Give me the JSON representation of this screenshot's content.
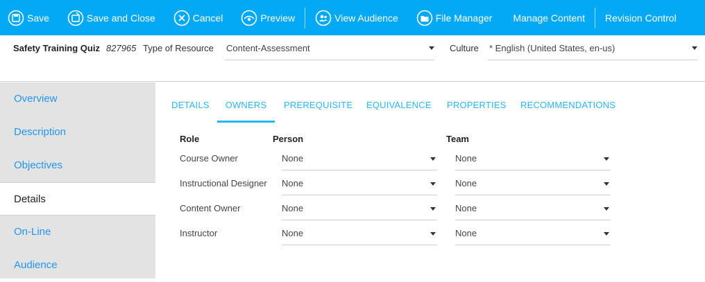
{
  "toolbar": {
    "save": "Save",
    "save_and_close": "Save and Close",
    "cancel": "Cancel",
    "preview": "Preview",
    "view_audience": "View Audience",
    "file_manager": "File Manager",
    "manage_content": "Manage Content",
    "revision_control": "Revision Control"
  },
  "header": {
    "title": "Safety Training Quiz",
    "id": "827965",
    "type_label": "Type of Resource",
    "type_value": "Content-Assessment",
    "culture_label": "Culture",
    "culture_value": "* English (United States, en-us)"
  },
  "sidebar": {
    "items": [
      {
        "label": "Overview"
      },
      {
        "label": "Description"
      },
      {
        "label": "Objectives"
      },
      {
        "label": "Details"
      },
      {
        "label": "On-Line"
      },
      {
        "label": "Audience"
      }
    ],
    "active": "Details"
  },
  "tabs": [
    {
      "label": "DETAILS"
    },
    {
      "label": "OWNERS"
    },
    {
      "label": "PREREQUISITE"
    },
    {
      "label": "EQUIVALENCE"
    },
    {
      "label": "PROPERTIES"
    },
    {
      "label": "RECOMMENDATIONS"
    }
  ],
  "owners": {
    "columns": {
      "role": "Role",
      "person": "Person",
      "team": "Team"
    },
    "rows": [
      {
        "role": "Course Owner",
        "person": "None",
        "team": "None"
      },
      {
        "role": "Instructional Designer",
        "person": "None",
        "team": "None"
      },
      {
        "role": "Content Owner",
        "person": "None",
        "team": "None"
      },
      {
        "role": "Instructor",
        "person": "None",
        "team": "None"
      }
    ]
  },
  "colors": {
    "toolbar": "#03a9f4",
    "link": "#2196f3",
    "sidebar_bg": "#e3e3e3"
  }
}
